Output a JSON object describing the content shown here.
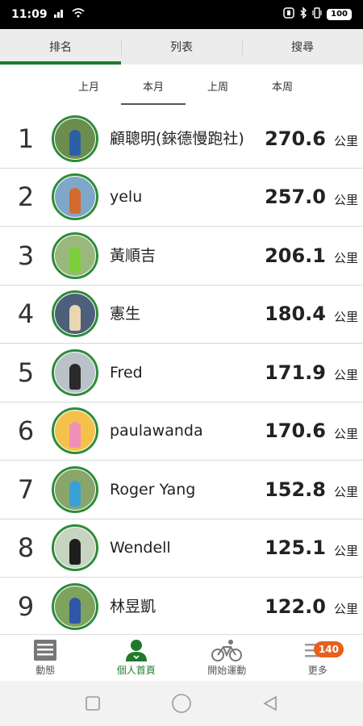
{
  "status_bar": {
    "time": "11:09",
    "battery": "100"
  },
  "top_tabs": [
    {
      "label": "排名",
      "active": true
    },
    {
      "label": "列表",
      "active": false
    },
    {
      "label": "搜尋",
      "active": false
    }
  ],
  "period_tabs": [
    {
      "label": "上月",
      "active": false
    },
    {
      "label": "本月",
      "active": true
    },
    {
      "label": "上周",
      "active": false
    },
    {
      "label": "本周",
      "active": false
    }
  ],
  "unit": "公里",
  "rankings": [
    {
      "rank": "1",
      "name": "顧聰明(錸德慢跑社)",
      "distance": "270.6",
      "avatar_bg": "#6b8e4e",
      "runner_color": "#2d5fa8"
    },
    {
      "rank": "2",
      "name": "yelu",
      "distance": "257.0",
      "avatar_bg": "#7fa7c9",
      "runner_color": "#d46a2b"
    },
    {
      "rank": "3",
      "name": "黃順吉",
      "distance": "206.1",
      "avatar_bg": "#9ab87d",
      "runner_color": "#7ccf3a"
    },
    {
      "rank": "4",
      "name": "憲生",
      "distance": "180.4",
      "avatar_bg": "#4d5f7a",
      "runner_color": "#e8d7b0"
    },
    {
      "rank": "5",
      "name": "Fred",
      "distance": "171.9",
      "avatar_bg": "#b9c2c9",
      "runner_color": "#2a2a2a"
    },
    {
      "rank": "6",
      "name": "paulawanda",
      "distance": "170.6",
      "avatar_bg": "#f4c24a",
      "runner_color": "#f08fb8"
    },
    {
      "rank": "7",
      "name": "Roger Yang",
      "distance": "152.8",
      "avatar_bg": "#8aa56a",
      "runner_color": "#3aa0d8"
    },
    {
      "rank": "8",
      "name": "Wendell",
      "distance": "125.1",
      "avatar_bg": "#c8d4c2",
      "runner_color": "#1e1e1e"
    },
    {
      "rank": "9",
      "name": "林昱凱",
      "distance": "122.0",
      "avatar_bg": "#7ea35c",
      "runner_color": "#3057a8"
    }
  ],
  "bottom_nav": [
    {
      "label": "動態",
      "icon": "news-icon",
      "active": false
    },
    {
      "label": "個人首頁",
      "icon": "person-icon",
      "active": true
    },
    {
      "label": "開始運動",
      "icon": "bicycle-icon",
      "active": false
    },
    {
      "label": "更多",
      "icon": "menu-icon",
      "active": false,
      "badge": "140"
    }
  ],
  "colors": {
    "accent": "#1f7a2e",
    "badge": "#e8601c"
  }
}
